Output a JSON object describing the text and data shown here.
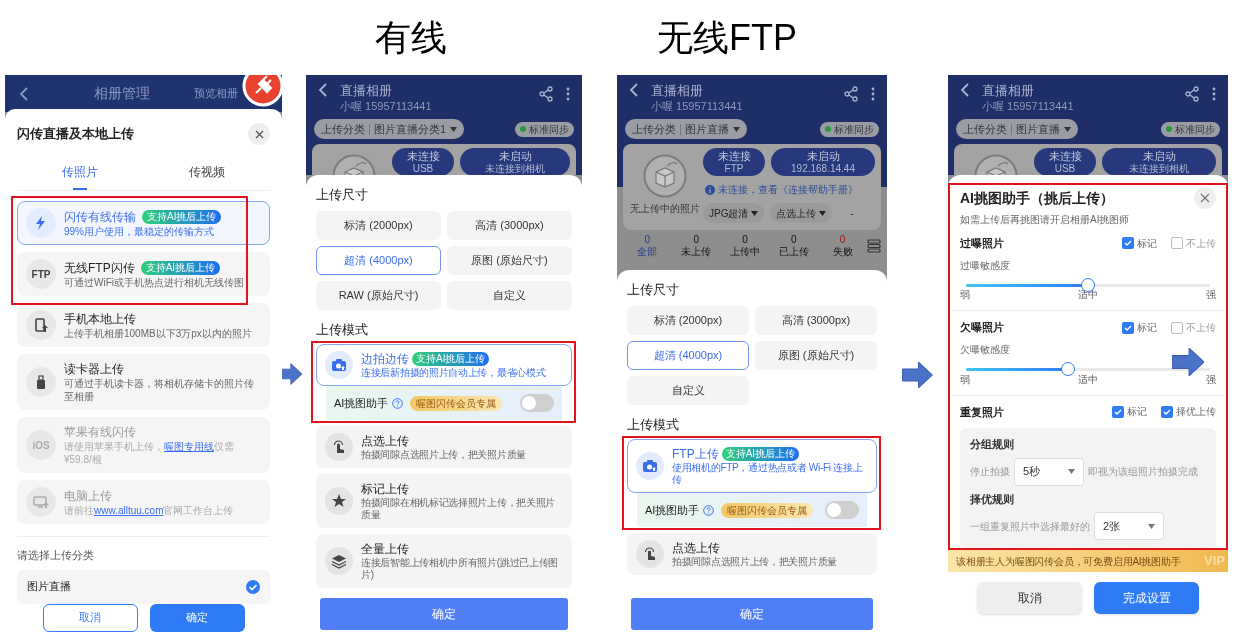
{
  "panels": [
    {
      "kind": "upload_menu",
      "topbar": {
        "title": "相册管理",
        "action": "预览相册"
      },
      "sheet_title": "闪传直播及本地上传",
      "tabs": [
        {
          "label": "传照片",
          "selected": true
        },
        {
          "label": "传视频",
          "selected": false
        }
      ],
      "options": [
        {
          "title": "闪传有线传输",
          "badge": "支持AI挑后上传",
          "description": "99%用户使用，最稳定的传输方式",
          "selected": true,
          "disabled": false,
          "highlighted": true
        },
        {
          "title": "无线FTP闪传",
          "badge": "支持AI挑后上传",
          "icon_text": "FTP",
          "description": "可通过WiFi或手机热点进行相机无线传图",
          "selected": false,
          "disabled": false,
          "highlighted": true
        },
        {
          "title": "手机本地上传",
          "description": "上传手机相册100MB以下3万px以内的照片",
          "selected": false,
          "disabled": false,
          "highlighted": false
        },
        {
          "title": "读卡器上传",
          "description": "可通过手机读卡器，将相机存储卡的照片传至相册",
          "selected": false,
          "disabled": false,
          "highlighted": false
        },
        {
          "title": "苹果有线闪传",
          "icon_text": "iOS",
          "description": "请使用苹果手机上传，",
          "link": "喔图专用线",
          "description_end": "仅需¥59.8/根",
          "selected": false,
          "disabled": true,
          "highlighted": false
        },
        {
          "title": "电脑上传",
          "description": "请前往",
          "link": "www.alltuu.com",
          "description_end": "官网工作台上传",
          "selected": false,
          "disabled": true,
          "highlighted": false
        }
      ],
      "category_label": "请选择上传分类",
      "categories": [
        {
          "label": "图片直播",
          "selected": true
        }
      ],
      "buttons": [
        "取消",
        "确定"
      ]
    },
    {
      "kind": "upload_settings",
      "heading": "有线",
      "album": {
        "title": "直播相册",
        "subtitle": "小喔 15957113441"
      },
      "category": {
        "label": "上传分类",
        "value": "图片直播分类1"
      },
      "sync": "标准同步",
      "connection": [
        {
          "state": "未连接",
          "detail": "USB"
        },
        {
          "state": "未启动",
          "detail": "未连接到相机"
        }
      ],
      "size_title": "上传尺寸",
      "sizes": [
        {
          "label": "标清 (2000px)",
          "selected": false
        },
        {
          "label": "高清 (3000px)",
          "selected": false
        },
        {
          "label": "超清 (4000px)",
          "selected": true
        },
        {
          "label": "原图 (原始尺寸)",
          "selected": false
        },
        {
          "label": "RAW (原始尺寸)",
          "selected": false
        },
        {
          "label": "自定义",
          "selected": false
        }
      ],
      "mode_title": "上传模式",
      "modes": [
        {
          "title": "边拍边传",
          "badge": "支持AI挑后上传",
          "description": "连接后新拍摄的照片自动上传，最省心模式",
          "selected": true,
          "highlighted": true,
          "ai_helper": {
            "label": "AI挑图助手",
            "badge": "喔图闪传会员专属",
            "on": false
          }
        },
        {
          "title": "点选上传",
          "description": "拍摄间隙点选照片上传，把关照片质量",
          "selected": false,
          "highlighted": false
        },
        {
          "title": "标记上传",
          "description": "拍摄间隙在相机标记选择照片上传，把关照片质量",
          "selected": false,
          "highlighted": false
        },
        {
          "title": "全量上传",
          "description": "连接后智能上传相机中所有照片(跳过已上传图片)",
          "selected": false,
          "highlighted": false
        }
      ],
      "confirm": "确定"
    },
    {
      "kind": "upload_settings",
      "heading": "无线FTP",
      "album": {
        "title": "直播相册",
        "subtitle": "小喔 15957113441"
      },
      "category": {
        "label": "上传分类",
        "value": "图片直播"
      },
      "sync": "标准同步",
      "connection": [
        {
          "state": "未连接",
          "detail": "FTP"
        },
        {
          "state": "未启动",
          "detail": "192.168.14.44"
        }
      ],
      "status": {
        "placeholder": "无上传中的照片",
        "notice": "未连接，查看《连接帮助手册》",
        "dropdowns": [
          "JPG超清",
          "点选上传"
        ],
        "dash": "-"
      },
      "counts": [
        {
          "value": "0",
          "label": "全部",
          "selected": true,
          "kind": "total"
        },
        {
          "value": "0",
          "label": "未上传",
          "selected": false,
          "kind": "normal"
        },
        {
          "value": "0",
          "label": "上传中",
          "selected": false,
          "kind": "normal"
        },
        {
          "value": "0",
          "label": "已上传",
          "selected": false,
          "kind": "normal"
        },
        {
          "value": "0",
          "label": "失败",
          "selected": false,
          "kind": "failed"
        }
      ],
      "size_title": "上传尺寸",
      "sizes": [
        {
          "label": "标清 (2000px)",
          "selected": false
        },
        {
          "label": "高清 (3000px)",
          "selected": false
        },
        {
          "label": "超清 (4000px)",
          "selected": true
        },
        {
          "label": "原图 (原始尺寸)",
          "selected": false
        },
        {
          "label": "自定义",
          "selected": false
        }
      ],
      "mode_title": "上传模式",
      "modes": [
        {
          "title": "FTP上传",
          "badge": "支持AI挑后上传",
          "description": "使用相机的FTP，通过热点或者 Wi-Fi 连接上传",
          "selected": true,
          "highlighted": true,
          "ai_helper": {
            "label": "AI挑图助手",
            "badge": "喔图闪传会员专属",
            "on": false
          }
        },
        {
          "title": "点选上传",
          "description": "拍摄间隙点选照片上传，把关照片质量",
          "selected": false,
          "highlighted": false
        }
      ],
      "confirm": "确定"
    },
    {
      "kind": "ai_helper",
      "album": {
        "title": "直播相册",
        "subtitle": "小喔 15957113441"
      },
      "category": {
        "label": "上传分类",
        "value": "图片直播"
      },
      "sync": "标准同步",
      "connection": [
        {
          "state": "未连接",
          "detail": "USB"
        },
        {
          "state": "未启动",
          "detail": "未连接到相机"
        }
      ],
      "highlighted": true,
      "title": "AI挑图助手（挑后上传）",
      "subtitle": "如需上传后再挑图请开启相册AI挑图师",
      "sections": [
        {
          "kind": "slider",
          "title": "过曝照片",
          "options": [
            {
              "label": "标记",
              "checked": true
            },
            {
              "label": "不上传",
              "checked": false
            }
          ],
          "slider_label": "过曝敏感度",
          "level": 0.5,
          "scale": [
            "弱",
            "适中",
            "强"
          ]
        },
        {
          "kind": "slider",
          "title": "欠曝照片",
          "options": [
            {
              "label": "标记",
              "checked": true
            },
            {
              "label": "不上传",
              "checked": false
            }
          ],
          "slider_label": "欠曝敏感度",
          "level": 0.42,
          "scale": [
            "弱",
            "适中",
            "强"
          ]
        },
        {
          "kind": "rules",
          "title": "重复照片",
          "options": [
            {
              "label": "标记",
              "checked": true
            },
            {
              "label": "择优上传",
              "checked": true
            }
          ],
          "rules": [
            {
              "title": "分组规则",
              "prefix": "停止拍摄",
              "value": "5秒",
              "suffix": "即视为该组照片拍摄完成"
            },
            {
              "title": "择优规则",
              "prefix": "一组重复照片中选择最好的",
              "value": "2张"
            }
          ]
        }
      ],
      "banner": "该相册主人为喔图闪传会员，可免费启用AI挑图助手",
      "banner_mark": "VIP",
      "buttons": [
        "取消",
        "完成设置"
      ]
    }
  ]
}
